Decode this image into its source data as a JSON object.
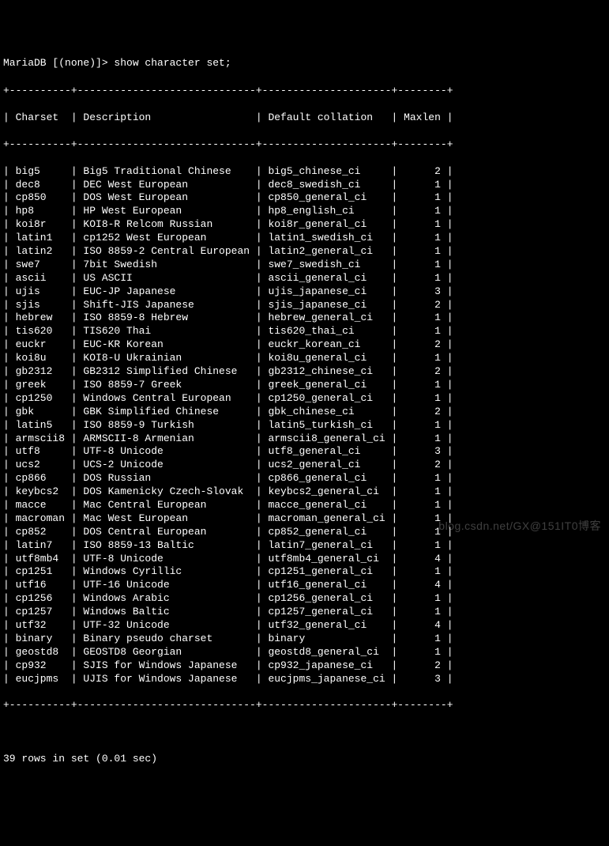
{
  "prompt": "MariaDB [(none)]> show character set;",
  "columns": [
    "Charset",
    "Description",
    "Default collation",
    "Maxlen"
  ],
  "rows": [
    {
      "charset": "big5",
      "description": "Big5 Traditional Chinese",
      "collation": "big5_chinese_ci",
      "maxlen": 2
    },
    {
      "charset": "dec8",
      "description": "DEC West European",
      "collation": "dec8_swedish_ci",
      "maxlen": 1
    },
    {
      "charset": "cp850",
      "description": "DOS West European",
      "collation": "cp850_general_ci",
      "maxlen": 1
    },
    {
      "charset": "hp8",
      "description": "HP West European",
      "collation": "hp8_english_ci",
      "maxlen": 1
    },
    {
      "charset": "koi8r",
      "description": "KOI8-R Relcom Russian",
      "collation": "koi8r_general_ci",
      "maxlen": 1
    },
    {
      "charset": "latin1",
      "description": "cp1252 West European",
      "collation": "latin1_swedish_ci",
      "maxlen": 1
    },
    {
      "charset": "latin2",
      "description": "ISO 8859-2 Central European",
      "collation": "latin2_general_ci",
      "maxlen": 1
    },
    {
      "charset": "swe7",
      "description": "7bit Swedish",
      "collation": "swe7_swedish_ci",
      "maxlen": 1
    },
    {
      "charset": "ascii",
      "description": "US ASCII",
      "collation": "ascii_general_ci",
      "maxlen": 1
    },
    {
      "charset": "ujis",
      "description": "EUC-JP Japanese",
      "collation": "ujis_japanese_ci",
      "maxlen": 3
    },
    {
      "charset": "sjis",
      "description": "Shift-JIS Japanese",
      "collation": "sjis_japanese_ci",
      "maxlen": 2
    },
    {
      "charset": "hebrew",
      "description": "ISO 8859-8 Hebrew",
      "collation": "hebrew_general_ci",
      "maxlen": 1
    },
    {
      "charset": "tis620",
      "description": "TIS620 Thai",
      "collation": "tis620_thai_ci",
      "maxlen": 1
    },
    {
      "charset": "euckr",
      "description": "EUC-KR Korean",
      "collation": "euckr_korean_ci",
      "maxlen": 2
    },
    {
      "charset": "koi8u",
      "description": "KOI8-U Ukrainian",
      "collation": "koi8u_general_ci",
      "maxlen": 1
    },
    {
      "charset": "gb2312",
      "description": "GB2312 Simplified Chinese",
      "collation": "gb2312_chinese_ci",
      "maxlen": 2
    },
    {
      "charset": "greek",
      "description": "ISO 8859-7 Greek",
      "collation": "greek_general_ci",
      "maxlen": 1
    },
    {
      "charset": "cp1250",
      "description": "Windows Central European",
      "collation": "cp1250_general_ci",
      "maxlen": 1
    },
    {
      "charset": "gbk",
      "description": "GBK Simplified Chinese",
      "collation": "gbk_chinese_ci",
      "maxlen": 2
    },
    {
      "charset": "latin5",
      "description": "ISO 8859-9 Turkish",
      "collation": "latin5_turkish_ci",
      "maxlen": 1
    },
    {
      "charset": "armscii8",
      "description": "ARMSCII-8 Armenian",
      "collation": "armscii8_general_ci",
      "maxlen": 1
    },
    {
      "charset": "utf8",
      "description": "UTF-8 Unicode",
      "collation": "utf8_general_ci",
      "maxlen": 3
    },
    {
      "charset": "ucs2",
      "description": "UCS-2 Unicode",
      "collation": "ucs2_general_ci",
      "maxlen": 2
    },
    {
      "charset": "cp866",
      "description": "DOS Russian",
      "collation": "cp866_general_ci",
      "maxlen": 1
    },
    {
      "charset": "keybcs2",
      "description": "DOS Kamenicky Czech-Slovak",
      "collation": "keybcs2_general_ci",
      "maxlen": 1
    },
    {
      "charset": "macce",
      "description": "Mac Central European",
      "collation": "macce_general_ci",
      "maxlen": 1
    },
    {
      "charset": "macroman",
      "description": "Mac West European",
      "collation": "macroman_general_ci",
      "maxlen": 1
    },
    {
      "charset": "cp852",
      "description": "DOS Central European",
      "collation": "cp852_general_ci",
      "maxlen": 1
    },
    {
      "charset": "latin7",
      "description": "ISO 8859-13 Baltic",
      "collation": "latin7_general_ci",
      "maxlen": 1
    },
    {
      "charset": "utf8mb4",
      "description": "UTF-8 Unicode",
      "collation": "utf8mb4_general_ci",
      "maxlen": 4
    },
    {
      "charset": "cp1251",
      "description": "Windows Cyrillic",
      "collation": "cp1251_general_ci",
      "maxlen": 1
    },
    {
      "charset": "utf16",
      "description": "UTF-16 Unicode",
      "collation": "utf16_general_ci",
      "maxlen": 4
    },
    {
      "charset": "cp1256",
      "description": "Windows Arabic",
      "collation": "cp1256_general_ci",
      "maxlen": 1
    },
    {
      "charset": "cp1257",
      "description": "Windows Baltic",
      "collation": "cp1257_general_ci",
      "maxlen": 1
    },
    {
      "charset": "utf32",
      "description": "UTF-32 Unicode",
      "collation": "utf32_general_ci",
      "maxlen": 4
    },
    {
      "charset": "binary",
      "description": "Binary pseudo charset",
      "collation": "binary",
      "maxlen": 1
    },
    {
      "charset": "geostd8",
      "description": "GEOSTD8 Georgian",
      "collation": "geostd8_general_ci",
      "maxlen": 1
    },
    {
      "charset": "cp932",
      "description": "SJIS for Windows Japanese",
      "collation": "cp932_japanese_ci",
      "maxlen": 2
    },
    {
      "charset": "eucjpms",
      "description": "UJIS for Windows Japanese",
      "collation": "eucjpms_japanese_ci",
      "maxlen": 3
    }
  ],
  "footer": "39 rows in set (0.01 sec)",
  "watermark": "blog.csdn.net/GX@151IT0博客",
  "widths": {
    "charset": 8,
    "description": 27,
    "collation": 19,
    "maxlen": 6
  }
}
